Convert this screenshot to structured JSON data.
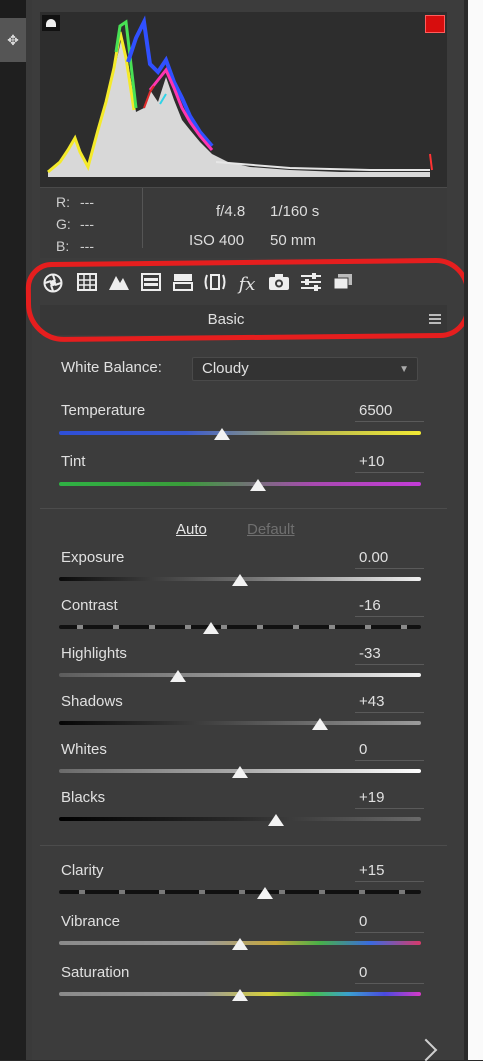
{
  "info": {
    "r_label": "R:",
    "r_value": "---",
    "g_label": "G:",
    "g_value": "---",
    "b_label": "B:",
    "b_value": "---",
    "aperture": "f/4.8",
    "shutter": "1/160 s",
    "iso": "ISO 400",
    "focal_length": "50 mm"
  },
  "tabs": [
    {
      "icon": "aperture-icon"
    },
    {
      "icon": "tone-curve-grid-icon"
    },
    {
      "icon": "detail-mountains-icon"
    },
    {
      "icon": "hsl-icon"
    },
    {
      "icon": "split-toning-icon"
    },
    {
      "icon": "lens-corrections-icon"
    },
    {
      "icon": "fx-icon"
    },
    {
      "icon": "camera-calibration-icon"
    },
    {
      "icon": "presets-sliders-icon"
    },
    {
      "icon": "snapshots-icon"
    }
  ],
  "section": {
    "title": "Basic"
  },
  "white_balance": {
    "label": "White Balance:",
    "value": "Cloudy"
  },
  "auto_label": "Auto",
  "default_label": "Default",
  "sliders": {
    "temperature": {
      "label": "Temperature",
      "value": "6500",
      "position": 0.45
    },
    "tint": {
      "label": "Tint",
      "value": "+10",
      "position": 0.55
    },
    "exposure": {
      "label": "Exposure",
      "value": "0.00",
      "position": 0.5
    },
    "contrast": {
      "label": "Contrast",
      "value": "-16",
      "position": 0.42
    },
    "highlights": {
      "label": "Highlights",
      "value": "-33",
      "position": 0.33
    },
    "shadows": {
      "label": "Shadows",
      "value": "+43",
      "position": 0.72
    },
    "whites": {
      "label": "Whites",
      "value": "0",
      "position": 0.5
    },
    "blacks": {
      "label": "Blacks",
      "value": "+19",
      "position": 0.6
    },
    "clarity": {
      "label": "Clarity",
      "value": "+15",
      "position": 0.57
    },
    "vibrance": {
      "label": "Vibrance",
      "value": "0",
      "position": 0.5
    },
    "saturation": {
      "label": "Saturation",
      "value": "0",
      "position": 0.5
    }
  },
  "colors": {
    "annotation_red": "#e61e1e",
    "clipping_warning": "#d70d0d"
  }
}
